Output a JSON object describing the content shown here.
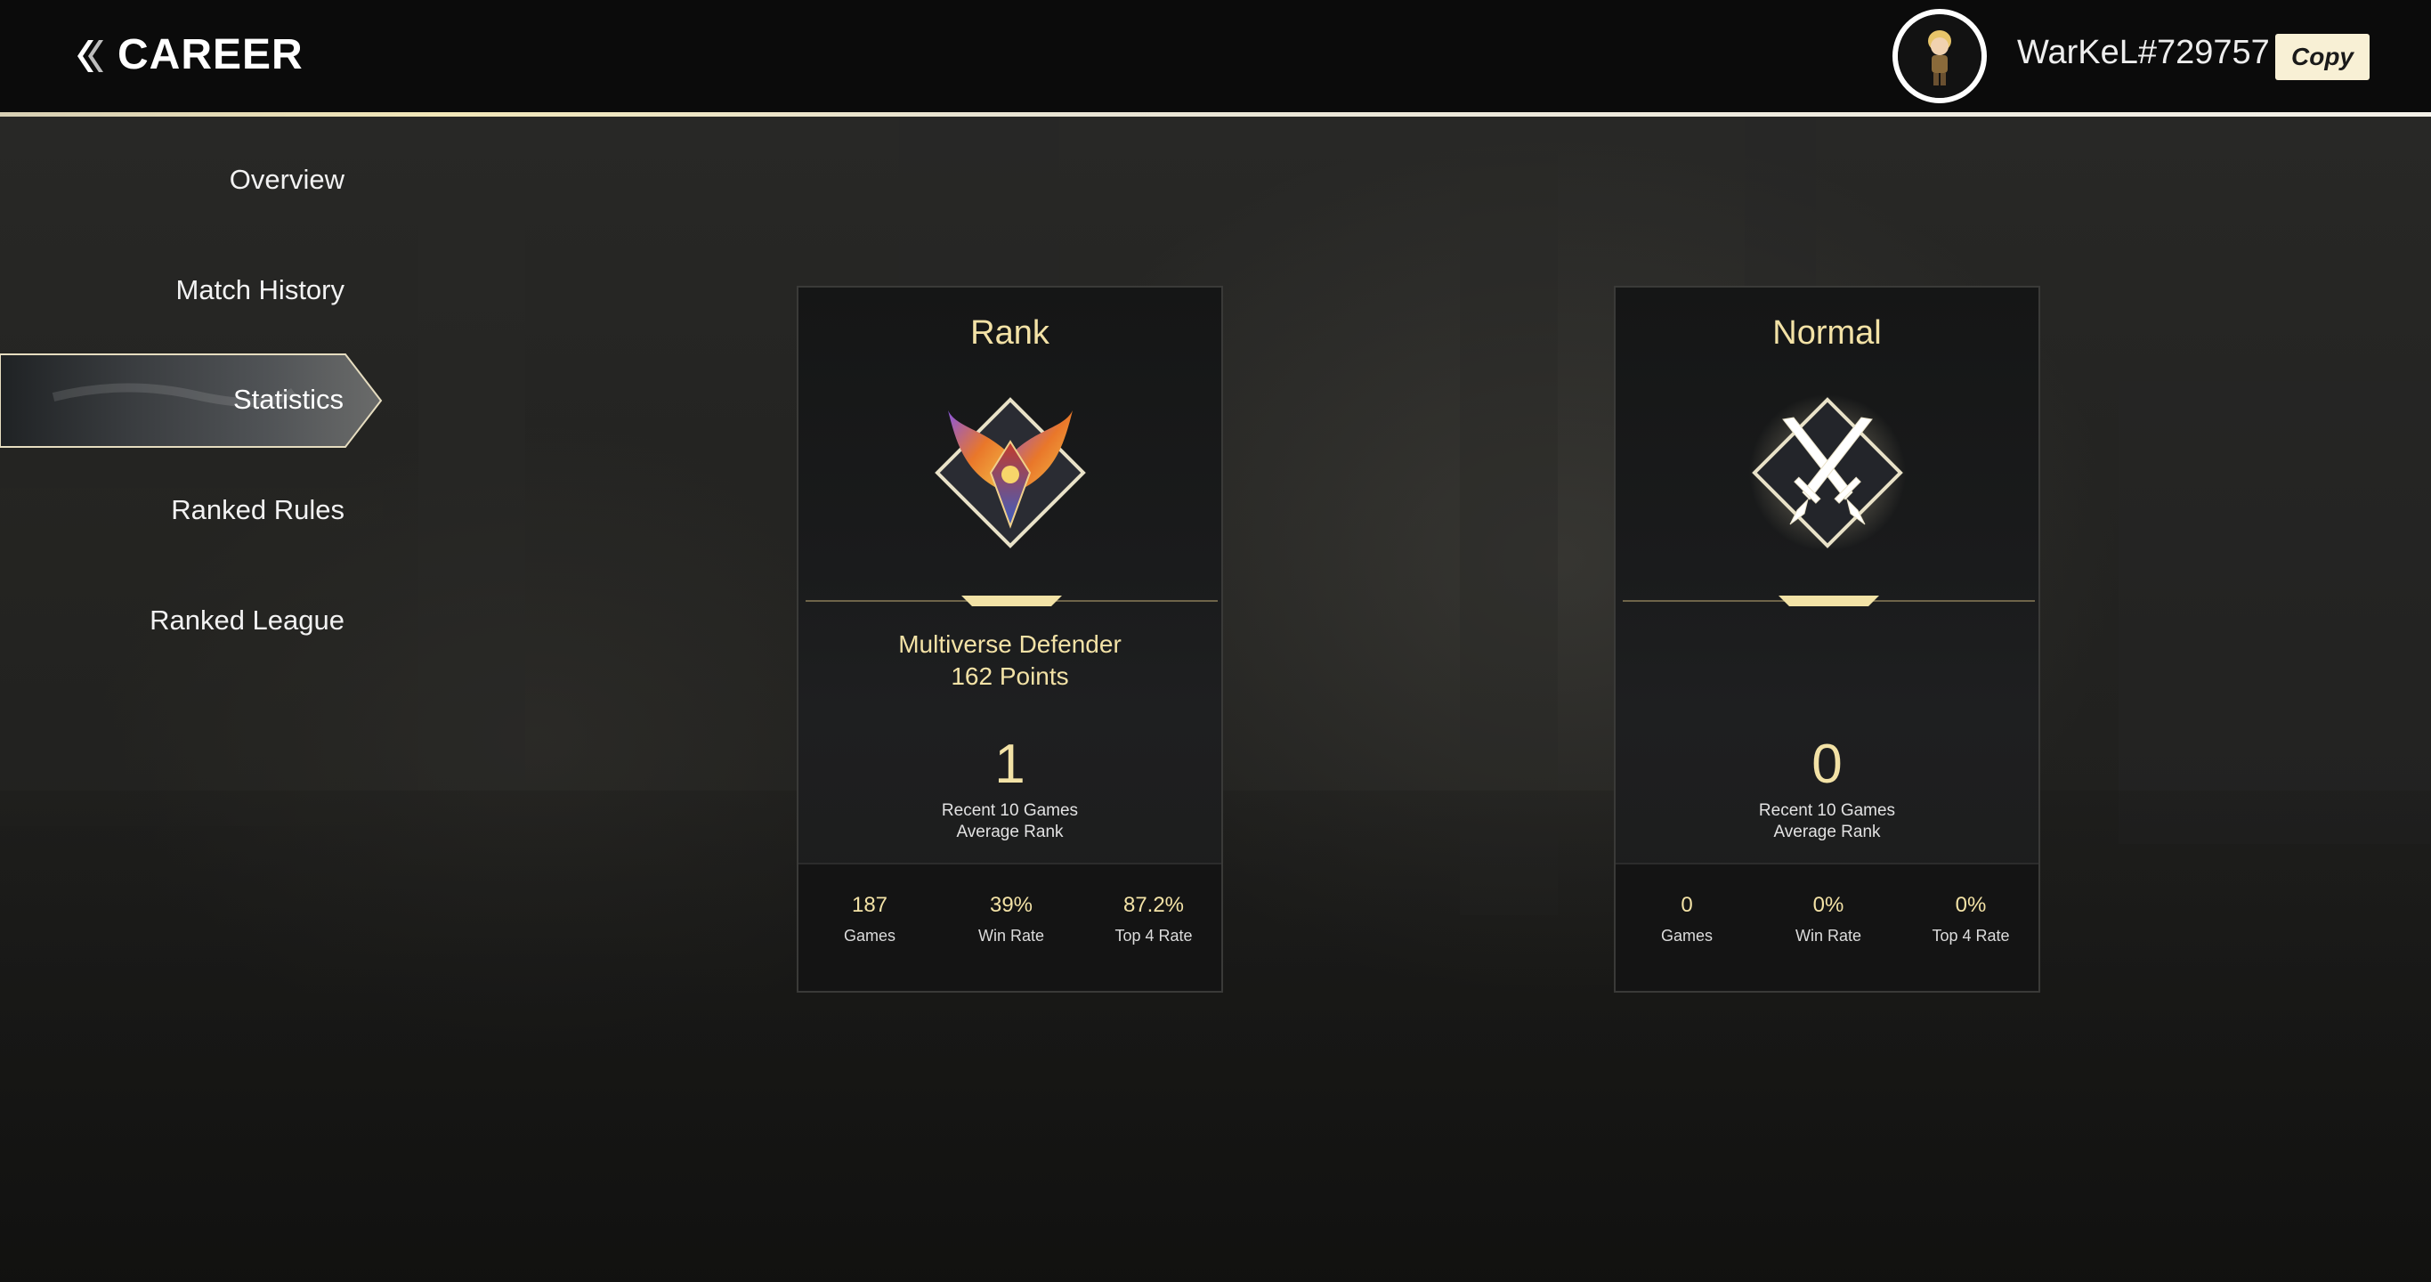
{
  "header": {
    "title": "CAREER",
    "username": "WarKeL#729757",
    "copy_label": "Copy"
  },
  "sidebar": {
    "items": [
      {
        "label": "Overview"
      },
      {
        "label": "Match History"
      },
      {
        "label": "Statistics",
        "active": true
      },
      {
        "label": "Ranked Rules"
      },
      {
        "label": "Ranked League"
      }
    ]
  },
  "cards": {
    "rank": {
      "title": "Rank",
      "tier": "Multiverse Defender",
      "points": "162 Points",
      "avg_rank": "1",
      "avg_label_1": "Recent 10 Games",
      "avg_label_2": "Average Rank",
      "stats": [
        {
          "value": "187",
          "label": "Games"
        },
        {
          "value": "39%",
          "label": "Win Rate"
        },
        {
          "value": "87.2%",
          "label": "Top 4 Rate"
        }
      ],
      "emblem_icon": "phoenix-rank-emblem-icon"
    },
    "normal": {
      "title": "Normal",
      "avg_rank": "0",
      "avg_label_1": "Recent 10 Games",
      "avg_label_2": "Average Rank",
      "stats": [
        {
          "value": "0",
          "label": "Games"
        },
        {
          "value": "0%",
          "label": "Win Rate"
        },
        {
          "value": "0%",
          "label": "Top 4 Rate"
        }
      ],
      "emblem_icon": "crossed-swords-icon"
    }
  },
  "colors": {
    "accent_gold": "#f3e2a6",
    "topbar_bg": "#0b0b0b",
    "copy_bg": "#f8f0d5"
  }
}
